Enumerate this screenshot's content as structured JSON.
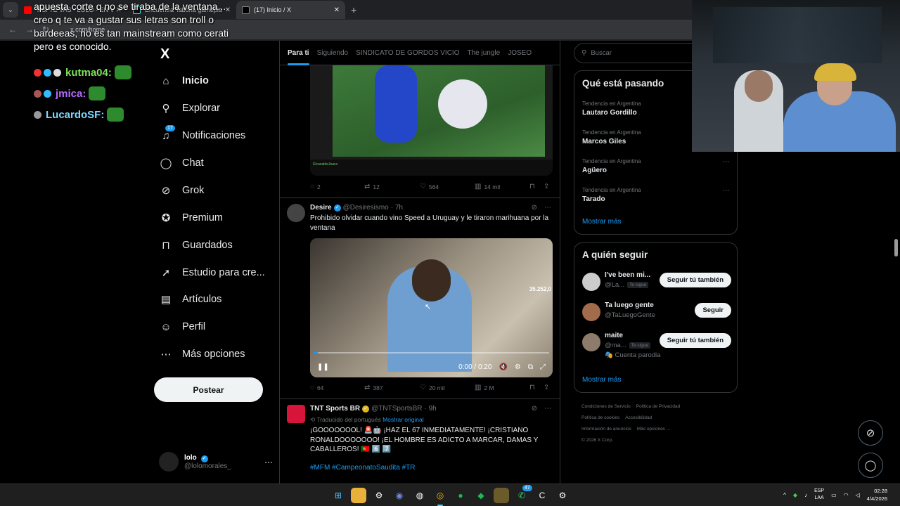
{
  "browser": {
    "tabs": [
      {
        "title": "Y SI TE VAS - LOLO - EN VIVO",
        "favicon_color": "#ff0000"
      },
      {
        "title": "Encuentra 'fabona gameplay' e",
        "favicon_color": "#25f4ee"
      },
      {
        "title": "(17) Inicio / X",
        "favicon_color": "#000000"
      }
    ],
    "url": "x.com/home"
  },
  "stream_overlay": {
    "text_lines": [
      "apuesta corte q no se tiraba de la ventana...",
      "creo q te va a gustar sus letras son troll o",
      "bardeeas, no es tan mainstream como cerati",
      "pero es conocido."
    ],
    "chat": [
      {
        "user": "kutma04:",
        "color": "#7fe05a"
      },
      {
        "user": "jmica:",
        "color": "#b86bff"
      },
      {
        "user": "LucardoSF:",
        "color": "#7fd9ff"
      }
    ]
  },
  "sidebar": {
    "logo": "X",
    "items": [
      {
        "label": "Inicio",
        "icon": "home-icon",
        "glyph": "⌂"
      },
      {
        "label": "Explorar",
        "icon": "search-icon",
        "glyph": "⚲"
      },
      {
        "label": "Notificaciones",
        "icon": "bell-icon",
        "glyph": "♫",
        "badge": "17"
      },
      {
        "label": "Chat",
        "icon": "chat-icon",
        "glyph": "◯"
      },
      {
        "label": "Grok",
        "icon": "grok-icon",
        "glyph": "⊘"
      },
      {
        "label": "Premium",
        "icon": "premium-icon",
        "glyph": "✪"
      },
      {
        "label": "Guardados",
        "icon": "bookmark-icon",
        "glyph": "⊓"
      },
      {
        "label": "Estudio para cre...",
        "icon": "rocket-icon",
        "glyph": "➚"
      },
      {
        "label": "Artículos",
        "icon": "article-icon",
        "glyph": "▤"
      },
      {
        "label": "Perfil",
        "icon": "person-icon",
        "glyph": "☺"
      },
      {
        "label": "Más opciones",
        "icon": "more-icon",
        "glyph": "⋯"
      }
    ],
    "post_button": "Postear",
    "account": {
      "name": "lolo",
      "handle": "@lolomorales_"
    }
  },
  "feed": {
    "tabs": [
      "Para ti",
      "Siguiendo",
      "SINDICATO DE GORDOS VICIO",
      "The jungle",
      "JOSEO"
    ],
    "post1": {
      "media_caption": "ElcanaldeJoaco",
      "replies": "2",
      "reposts": "12",
      "likes": "564",
      "views": "14 mil"
    },
    "post2": {
      "name": "Desire",
      "handle": "@Desiresismo",
      "time": "· 7h",
      "text": "Prohibido olvidar cuando vino Speed a Uruguay y le tiraron marihuana por la ventana",
      "video_counter": "35.252,0",
      "video_time": "0:00 / 0:20",
      "replies": "64",
      "reposts": "387",
      "likes": "20 mil",
      "views": "2 M"
    },
    "post3": {
      "name": "TNT Sports BR",
      "handle": "@TNTSportsBR",
      "time": "· 9h",
      "translated": "Traducido del portugués",
      "show_original": "Mostrar original",
      "text": "¡GOOOOOOOL! 🚨🤖 ¡HAZ EL 67 INMEDIATAMENTE! ¡CRISTIANO RONALDOOOOOOO! ¡EL HOMBRE ES ADICTO A MARCAR, DAMAS Y CABALLEROS! 🇵🇹 6️⃣ 7️⃣",
      "hashtags": "#MFM #CampeonatoSaudita #TR"
    }
  },
  "right": {
    "search_placeholder": "Buscar",
    "trends_title": "Qué está pasando",
    "trends": [
      {
        "label": "Tendencia en Argentina",
        "name": "Lautaro Gordillo"
      },
      {
        "label": "Tendencia en Argentina",
        "name": "Marcos Giles"
      },
      {
        "label": "Tendencia en Argentina",
        "name": "Agüero"
      },
      {
        "label": "Tendencia en Argentina",
        "name": "Tarado"
      }
    ],
    "trends_more": "Mostrar más",
    "follow_title": "A quién seguir",
    "follows": [
      {
        "name": "I've been mi...",
        "handle": "@La...",
        "follows_you": "Te sigue",
        "button": "Seguir tú también"
      },
      {
        "name": "Ta luego gente",
        "handle": "@TaLuegoGente",
        "follows_you": "",
        "button": "Seguir"
      },
      {
        "name": "maite",
        "handle": "@ma...",
        "follows_you": "Te sigue",
        "button": "Seguir tú también",
        "extra": "🎭 Cuenta parodia"
      }
    ],
    "follow_more": "Mostrar más",
    "footer": [
      "Condiciones de Servicio",
      "Política de Privacidad",
      "Política de cookies",
      "Accesibilidad",
      "Información de anuncios",
      "Más opciones ...",
      "© 2026 X Corp."
    ]
  },
  "taskbar": {
    "lang": "ESP",
    "lang2": "LAA",
    "time": "02:28",
    "date": "4/4/2026",
    "whatsapp_badge": "47"
  }
}
